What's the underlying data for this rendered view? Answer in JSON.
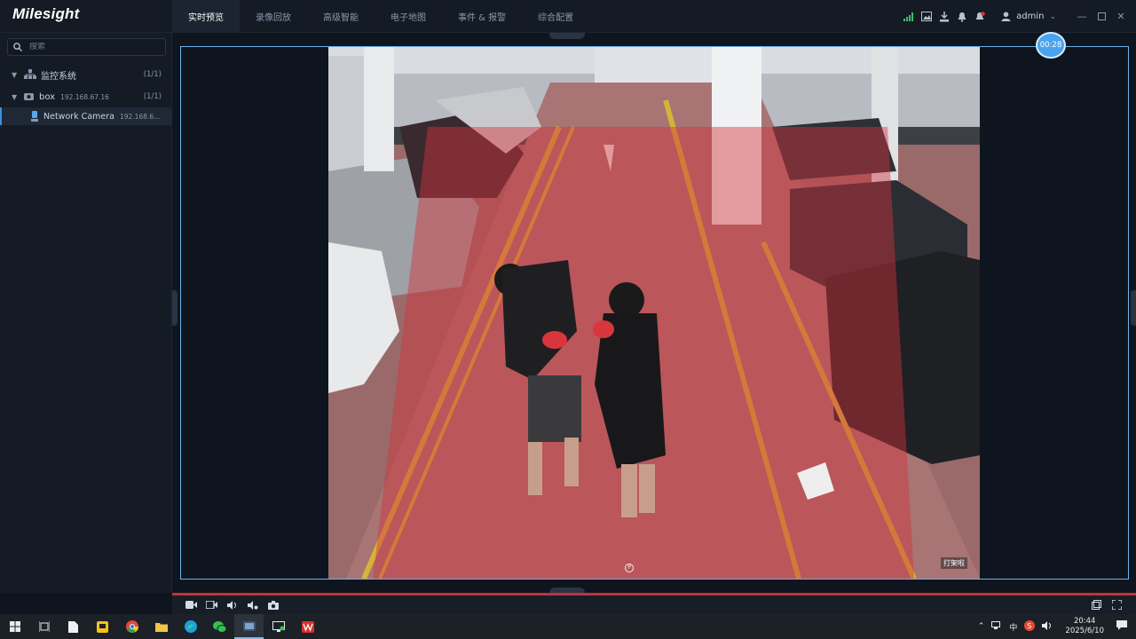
{
  "app": {
    "logo_text": "Milesight"
  },
  "nav": {
    "items": [
      {
        "label": "实时预览",
        "active": true
      },
      {
        "label": "录像回放"
      },
      {
        "label": "高级智能"
      },
      {
        "label": "电子地图"
      },
      {
        "label": "事件 & 报警"
      },
      {
        "label": "综合配置"
      }
    ]
  },
  "header": {
    "icons": [
      "signal-icon",
      "image-icon",
      "download-icon",
      "bell-icon",
      "alarm-icon"
    ],
    "user": "admin"
  },
  "sidebar": {
    "search_placeholder": "搜索",
    "tree": [
      {
        "label": "监控系统",
        "count": "(1/1)"
      },
      {
        "label": "box",
        "ip": "192.168.67.16",
        "count": "(1/1)"
      },
      {
        "label": "Network Camera",
        "ip": "192.168.6..."
      }
    ]
  },
  "video": {
    "timer": "00:28",
    "overlay_label": "打架啦",
    "colors": {
      "zone": "#d2323c",
      "frame": "#6eb3ea"
    }
  },
  "taskbar": {
    "ime": "中",
    "time": "20:44",
    "date": "2025/6/10"
  }
}
